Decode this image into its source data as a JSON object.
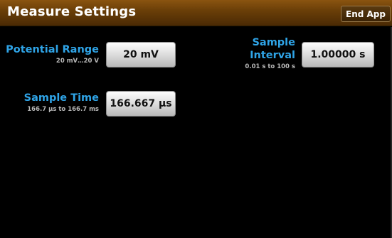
{
  "header": {
    "title": "Measure Settings",
    "end_app_label": "End App"
  },
  "settings": {
    "potential_range": {
      "label": "Potential Range",
      "range": "20 mV…20 V",
      "value": "20 mV"
    },
    "sample_interval": {
      "label_line1": "Sample",
      "label_line2": "Interval",
      "range": "0.01 s to 100 s",
      "value": "1.00000 s"
    },
    "sample_time": {
      "label": "Sample Time",
      "range": "166.7 µs to 166.7 ms",
      "value": "166.667 µs"
    }
  },
  "colors": {
    "header_bg": "#6b3f08",
    "label_blue": "#2fa4e7",
    "background": "#000000"
  }
}
